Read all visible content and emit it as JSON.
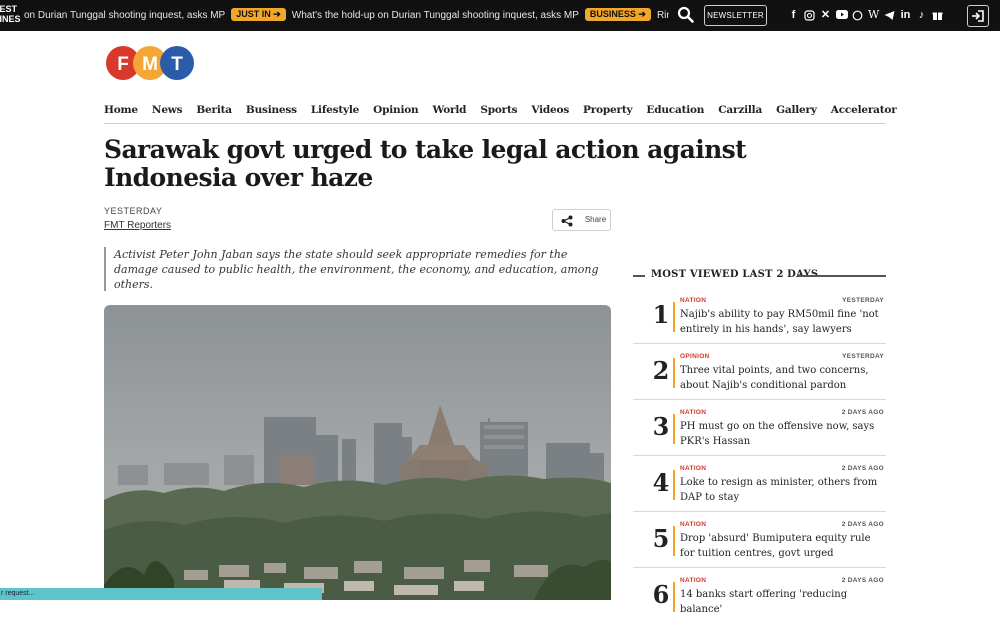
{
  "topbar": {
    "latest_label_line1": "TEST",
    "latest_label_line2": "LINES",
    "ticker": [
      {
        "text": "on Durian Tunggal shooting inquest, asks MP",
        "badge": "JUST IN ➔"
      },
      {
        "text": "What's the hold-up on Durian Tunggal shooting inquest, asks MP",
        "badge": "BUSINESS ➔"
      },
      {
        "text": "Ringgit opens mixed ag",
        "badge": ""
      }
    ],
    "newsletter_label": "NEWSLETTER",
    "social_icons": [
      "facebook-icon",
      "instagram-icon",
      "x-icon",
      "youtube-icon",
      "whatsapp-icon",
      "wikipedia-icon",
      "telegram-icon",
      "linkedin-icon",
      "tiktok-icon",
      "gift-icon"
    ]
  },
  "logo": {
    "letters": [
      "F",
      "M",
      "T"
    ],
    "colors": [
      "#d7392a",
      "#f4a736",
      "#2a5caa"
    ]
  },
  "nav": {
    "items": [
      "Home",
      "News",
      "Berita",
      "Business",
      "Lifestyle",
      "Opinion",
      "World",
      "Sports",
      "Videos",
      "Property",
      "Education",
      "Carzilla",
      "Gallery",
      "Accelerator"
    ]
  },
  "article": {
    "headline": "Sarawak govt urged to take legal action against Indonesia over haze",
    "date": "YESTERDAY",
    "author": "FMT Reporters",
    "share_label": "Share",
    "lede": "Activist Peter John Jaban says the state should seek appropriate remedies for the damage caused to public health, the environment, the economy, and education, among others."
  },
  "most_viewed": {
    "title": "MOST VIEWED LAST 2 DAYS",
    "items": [
      {
        "rank": "1",
        "category": "NATION",
        "time": "YESTERDAY",
        "headline": "Najib's ability to pay RM50mil fine 'not entirely in his hands', say lawyers"
      },
      {
        "rank": "2",
        "category": "OPINION",
        "time": "YESTERDAY",
        "headline": "Three vital points, and two concerns, about Najib's conditional pardon"
      },
      {
        "rank": "3",
        "category": "NATION",
        "time": "2 DAYS AGO",
        "headline": "PH must go on the offensive now, says PKR's Hassan"
      },
      {
        "rank": "4",
        "category": "NATION",
        "time": "2 DAYS AGO",
        "headline": "Loke to resign as minister, others from DAP to stay"
      },
      {
        "rank": "5",
        "category": "NATION",
        "time": "2 DAYS AGO",
        "headline": "Drop 'absurd' Bumiputera equity rule for tuition centres, govt urged"
      },
      {
        "rank": "6",
        "category": "NATION",
        "time": "2 DAYS AGO",
        "headline": "14 banks start offering 'reducing balance'"
      }
    ]
  },
  "status": {
    "text": "r request..."
  }
}
